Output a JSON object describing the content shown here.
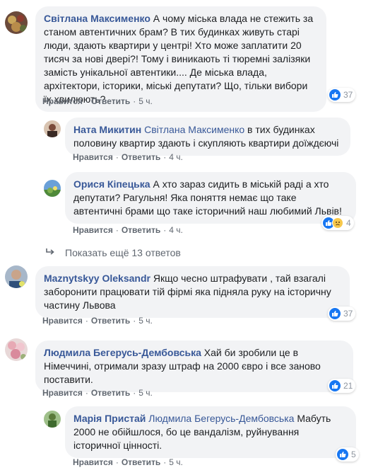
{
  "actions": {
    "like": "Нравится",
    "reply": "Ответить",
    "sep": "·"
  },
  "comments": [
    {
      "author": "Світлана Максименко",
      "text": "А чому міська влада не стежить за станом автентичних брам? В тих будинках живуть старі люди, здають квартири у центрі! Хто може заплатити 20 тисяч за нові двері?! Тому і виникають ті тюремні залізяки замість унікальної автентики.... Де міська влада, архітектори, історики, міські депутати? Що, тільки вибори їх хвилюють?",
      "time": "5 ч.",
      "reactions": "37"
    },
    {
      "author": "Ната Микитин",
      "mention": "Світлана Максименко",
      "text": " в тих будинках половину квартир здають і скупляють квартири доїждєючі",
      "time": "4 ч."
    },
    {
      "author": "Орися Кіпецька",
      "text": "А хто зараз сидить в міській раді а хто депутати? Рагульня! Яка поняття немає що таке автентичні брами що таке історичний наш любимий Львів!",
      "time": "4 ч.",
      "reactions": "4"
    },
    {
      "author": "Maznytskyy Oleksandr",
      "text": "Якщо чесно штрафувати , тай взагалі заборонити працювати тій фірмі яка підняла руку на історичну частину Львова",
      "time": "5 ч.",
      "reactions": "37"
    },
    {
      "author": "Людмила Бегерусь-Дембовська",
      "text": "Хай би зробили це в Німеччині, отримали зразу штраф на 2000 євро і все заново поставити.",
      "time": "5 ч.",
      "reactions": "21"
    },
    {
      "author": "Марія Пристай",
      "mention": "Людмила Бегерусь-Дембовська",
      "text": " Мабуть 2000 не обійшлося, бо це вандалізм, руйнування історичної цінності.",
      "time": "5 ч.",
      "reactions": "5"
    }
  ],
  "more_replies": "Показать ещё 13 ответов",
  "colors": {
    "link": "#385898",
    "bubble": "#f2f3f5",
    "like_blue": "#1877f2",
    "meta": "#606770"
  }
}
